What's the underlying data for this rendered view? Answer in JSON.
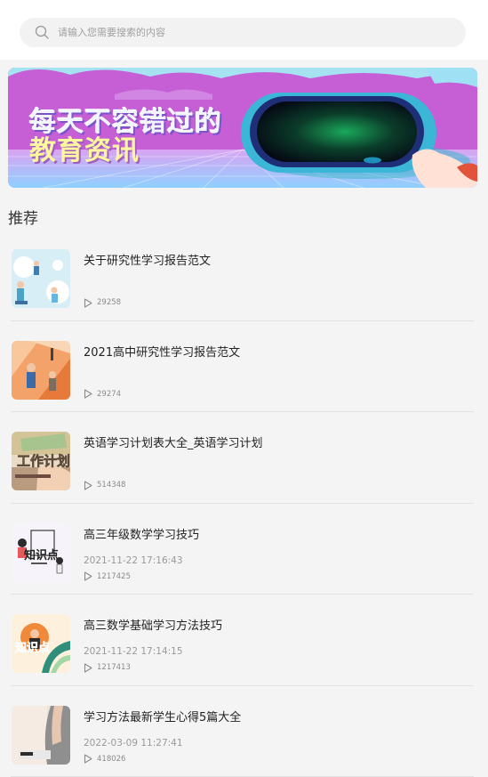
{
  "search": {
    "placeholder": "请输入您需要搜索的内容"
  },
  "banner": {
    "line1": "每天不容错过的",
    "line2": "教育资讯"
  },
  "section": {
    "title": "推荐"
  },
  "items": [
    {
      "title": "关于研究性学习报告范文",
      "date": "",
      "views": "29258",
      "thumb": "illustration-people"
    },
    {
      "title": "2021高中研究性学习报告范文",
      "date": "",
      "views": "29274",
      "thumb": "illustration-orange"
    },
    {
      "title": "英语学习计划表大全_英语学习计划",
      "date": "",
      "views": "514348",
      "thumb": "illustration-plan"
    },
    {
      "title": "高三年级数学学习技巧",
      "date": "2021-11-22 17:16:43",
      "views": "1217425",
      "thumb": "illustration-knowledge"
    },
    {
      "title": "高三数学基础学习方法技巧",
      "date": "2021-11-22 17:14:15",
      "views": "1217413",
      "thumb": "illustration-knowledge-orange"
    },
    {
      "title": "学习方法最新学生心得5篇大全",
      "date": "2022-03-09 11:27:41",
      "views": "418026",
      "thumb": "illustration-desk"
    }
  ],
  "thumb_texts": {
    "plan": "工作计划",
    "knowledge": "知识点"
  }
}
